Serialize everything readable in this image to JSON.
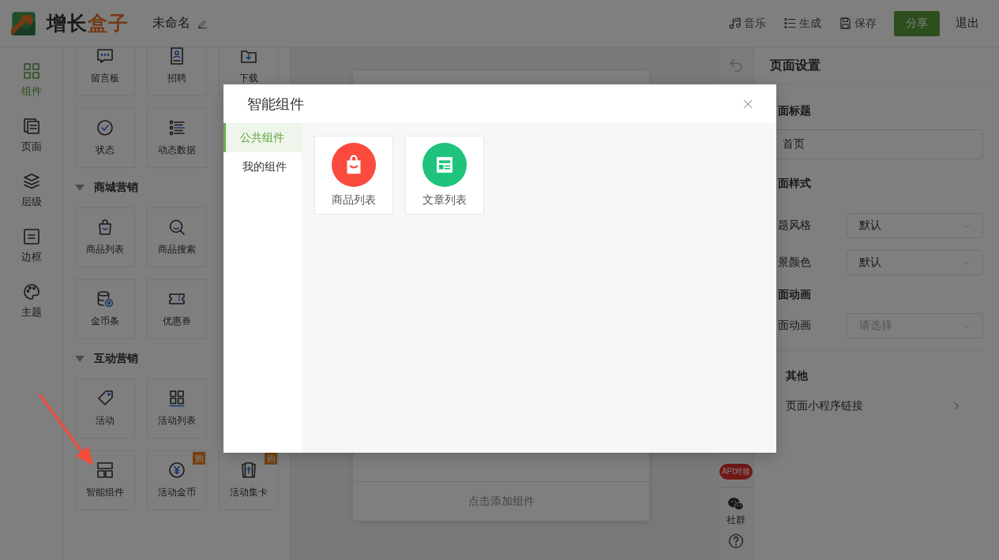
{
  "header": {
    "brand": [
      "增长",
      "盒子"
    ],
    "title": "未命名",
    "actions": [
      {
        "label": "音乐"
      },
      {
        "label": "生成"
      },
      {
        "label": "保存"
      }
    ],
    "share_button": "分享",
    "exit": "退出"
  },
  "rail": [
    {
      "label": "组件",
      "selected": true
    },
    {
      "label": "页面",
      "selected": false
    },
    {
      "label": "层级",
      "selected": false
    },
    {
      "label": "边框",
      "selected": false
    },
    {
      "label": "主题",
      "selected": false
    }
  ],
  "component_groups": [
    {
      "items": [
        {
          "label": "留言板"
        },
        {
          "label": "招聘"
        },
        {
          "label": "下载"
        },
        {
          "label": "状态"
        },
        {
          "label": "动态数据"
        }
      ]
    },
    {
      "title": "商城营销",
      "items": [
        {
          "label": "商品列表"
        },
        {
          "label": "商品搜索"
        },
        {
          "label": "金币条"
        },
        {
          "label": "优惠券"
        }
      ]
    },
    {
      "title": "互动营销",
      "items": [
        {
          "label": "活动"
        },
        {
          "label": "活动列表"
        },
        {
          "label": "智能组件"
        },
        {
          "label": "活动金币",
          "badge": "购"
        },
        {
          "label": "活动集卡",
          "badge": "购"
        }
      ]
    }
  ],
  "canvas": {
    "add_hint": "点击添加组件"
  },
  "tool_strip": {
    "api_badge": "API对接",
    "community": "社群"
  },
  "settings": {
    "title": "页面设置",
    "page_title": {
      "label": "面标题",
      "value": "首页"
    },
    "style_heading": "面样式",
    "theme": {
      "label": "题风格",
      "value": "默认"
    },
    "background": {
      "label": "景颜色",
      "value": "默认"
    },
    "animation_heading": "面动画",
    "animation": {
      "label": "面动画",
      "placeholder": "请选择"
    },
    "other_heading": "其他",
    "mini_program_link": "页面小程序链接"
  },
  "modal": {
    "title": "智能组件",
    "nav": [
      {
        "label": "公共组件",
        "selected": true
      },
      {
        "label": "我的组件",
        "selected": false
      }
    ],
    "cards": [
      {
        "label": "商品列表",
        "color": "#fa4b3e"
      },
      {
        "label": "文章列表",
        "color": "#1fc37b"
      }
    ]
  }
}
